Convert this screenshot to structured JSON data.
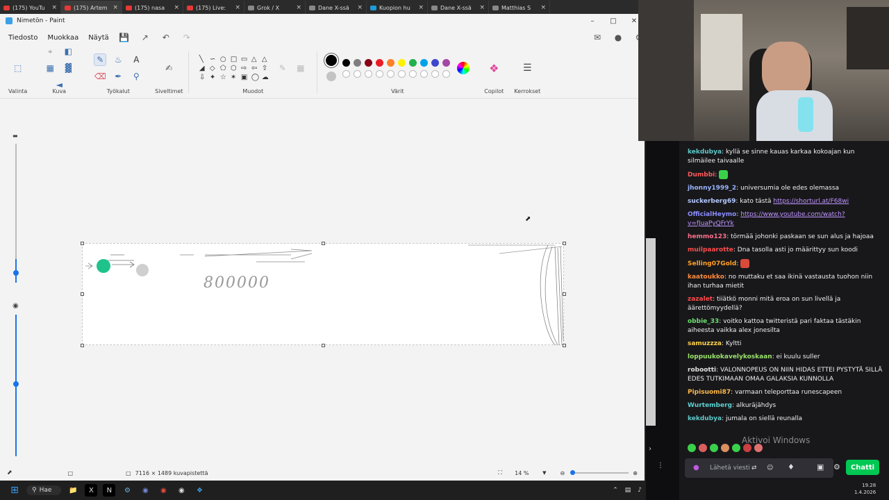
{
  "browser_tabs": [
    {
      "label": "(175) YouTu",
      "color": "#e53935"
    },
    {
      "label": "(175) Artem",
      "color": "#e53935"
    },
    {
      "label": "(175) nasa",
      "color": "#e53935"
    },
    {
      "label": "(175) Live:",
      "color": "#e53935"
    },
    {
      "label": "Grok / X",
      "color": "#888888"
    },
    {
      "label": "Dane X-ssä",
      "color": "#888888"
    },
    {
      "label": "Kuopion hu",
      "color": "#1e9bd7"
    },
    {
      "label": "Dane X-ssä",
      "color": "#888888"
    },
    {
      "label": "Matthias S",
      "color": "#888888"
    }
  ],
  "window": {
    "title": "Nimetön - Paint"
  },
  "menu": {
    "file": "Tiedosto",
    "edit": "Muokkaa",
    "view": "Näytä"
  },
  "ribbon": {
    "select_label": "Valinta",
    "image_label": "Kuva",
    "tools_label": "Työkalut",
    "brushes_label": "Siveltimet",
    "shapes_label": "Muodot",
    "colors_label": "Värit",
    "copilot_label": "Copilot",
    "layers_label": "Kerrokset",
    "palette_row1": [
      "#000000",
      "#7f7f7f",
      "#880015",
      "#ed1c24",
      "#ff7f27",
      "#fff200",
      "#22b14c",
      "#00a2e8",
      "#3f48cc",
      "#a349a4"
    ],
    "palette_row2": [
      "#ffffff",
      "#c3c3c3",
      "#b97a57",
      "#ffaec9",
      "#ffc90e",
      "#efe4b0",
      "#b5e61d",
      "#99d9ea",
      "#7092be",
      "#c8bfe7"
    ]
  },
  "canvas": {
    "handwritten_text": "800000"
  },
  "status": {
    "size_text": "7116 × 1489 kuvapistettä",
    "zoom": "14 %"
  },
  "taskbar": {
    "search": "Hae"
  },
  "chat": {
    "messages": [
      {
        "user": "kekdubya",
        "color": "#5cc8c8",
        "text": "kyllä se sinne kauas karkaa kokoajan kun silmäilee taivaalle"
      },
      {
        "user": "Dumbbi",
        "color": "#ff5a5a",
        "text": ""
      },
      {
        "user": "jhonny1999_2",
        "color": "#9ab4ff",
        "text": "universumia ole edes olemassa"
      },
      {
        "user": "suckerberg69",
        "color": "#b4c8ff",
        "text": "kato tästä ",
        "link": "https://shorturl.at/F68wi"
      },
      {
        "user": "OfficialHeymo",
        "color": "#8c8cff",
        "text": "",
        "link": "https://www.youtube.com/watch?v=fJuaPyQFrYk"
      },
      {
        "user": "hemmo123",
        "color": "#ff6e8c",
        "text": "törmää johonki paskaan se sun alus ja hajoaa"
      },
      {
        "user": "muilpaarotte",
        "color": "#ff4a4a",
        "text": "Dna tasolla asti jo määrittyy sun koodi"
      },
      {
        "user": "Selling07Gold",
        "color": "#ffa028",
        "text": ""
      },
      {
        "user": "kaatoukko",
        "color": "#ff8a3c",
        "text": "no muttaku et saa ikinä vastausta tuohon niin ihan turhaa mietit"
      },
      {
        "user": "zazalet",
        "color": "#ff4a4a",
        "text": "tiiätkö monni mitä eroa on sun livellä ja äärettömyydellä?"
      },
      {
        "user": "obbie_33",
        "color": "#6ee06e",
        "text": "voitko kattoa twitteristä pari faktaa tästäkin aiheesta vaikka alex jonesilta"
      },
      {
        "user": "samuzzza",
        "color": "#ffd24a",
        "text": "Kyltti"
      },
      {
        "user": "loppuukokavelykoskaan",
        "color": "#9be36b",
        "text": "ei kuulu suller"
      },
      {
        "user": "robootti",
        "color": "#e0e0e0",
        "text": "VALONNOPEUS ON NIIN HIDAS ETTEI PYSTYTÄ SILLÄ EDES TUTKIMAAN OMAA GALAKSIA KUNNOLLA"
      },
      {
        "user": "Pipisuomi87",
        "color": "#ffb84a",
        "text": "varmaan teleporttaa runescapeen"
      },
      {
        "user": "Wurtemberg",
        "color": "#5cd0d0",
        "text": "alkuräjähdys"
      },
      {
        "user": "kekdubya",
        "color": "#5cc8c8",
        "text": "jumala on siellä reunalla"
      }
    ],
    "input_placeholder": "Lähetä viesti",
    "send_label": "Chatti",
    "watermark": "Aktivoi Windows"
  },
  "clock": {
    "time": "19.28",
    "date": "1.4.2026"
  }
}
